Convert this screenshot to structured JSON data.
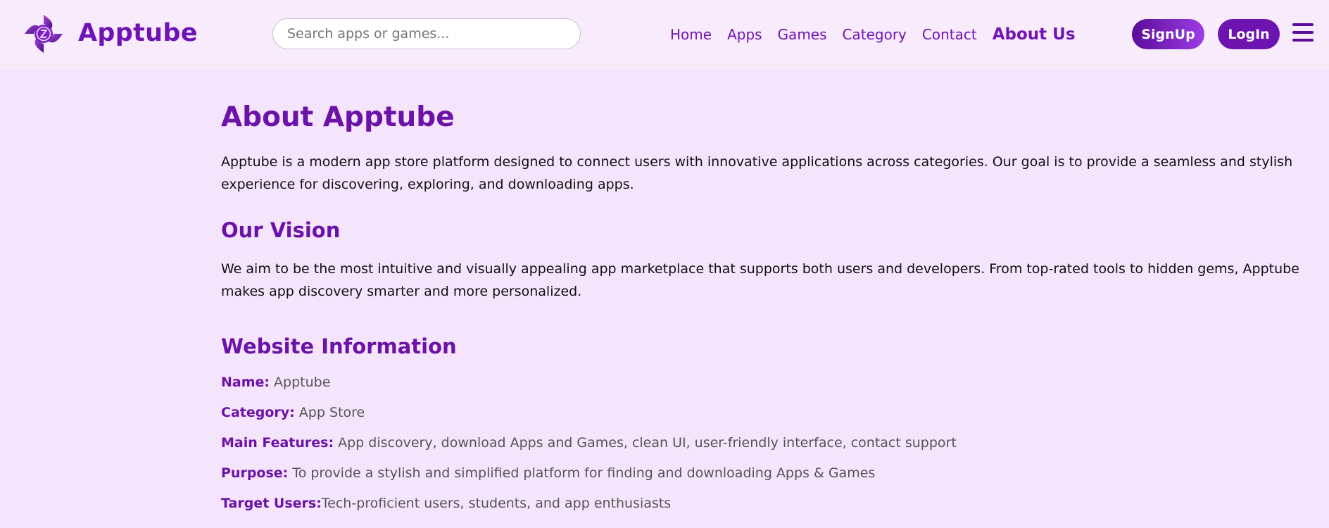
{
  "header": {
    "brand": "Apptube",
    "logo_icon": "apptube-logo-icon",
    "search_placeholder": "Search apps or games...",
    "nav": [
      {
        "label": "Home"
      },
      {
        "label": "Apps"
      },
      {
        "label": "Games"
      },
      {
        "label": "Category"
      },
      {
        "label": "Contact"
      },
      {
        "label": "About Us",
        "active": true
      }
    ],
    "signup_label": "SignUp",
    "login_label": "LogIn",
    "menu_icon": "hamburger-menu-icon"
  },
  "main": {
    "title": "About Apptube",
    "intro": "Apptube is a modern app store platform designed to connect users with innovative applications across categories. Our goal is to provide a seamless and stylish experience for discovering, exploring, and downloading apps.",
    "vision_title": "Our Vision",
    "vision_text": "We aim to be the most intuitive and visually appealing app marketplace that supports both users and developers. From top-rated tools to hidden gems, Apptube makes app discovery smarter and more personalized.",
    "info_title": "Website Information",
    "info": [
      {
        "label": "Name:",
        "value": " Apptube"
      },
      {
        "label": "Category:",
        "value": " App Store"
      },
      {
        "label": "Main Features:",
        "value": " App discovery, download Apps and Games, clean UI, user-friendly interface, contact support"
      },
      {
        "label": "Purpose:",
        "value": " To provide a stylish and simplified platform for finding and downloading Apps & Games"
      },
      {
        "label": "Target Users:",
        "value": "Tech-proficient users, students, and app enthusiasts"
      }
    ]
  },
  "colors": {
    "accent": "#7013b5",
    "page_bg": "#f4e4fc",
    "header_bg": "#f8ebfc"
  }
}
